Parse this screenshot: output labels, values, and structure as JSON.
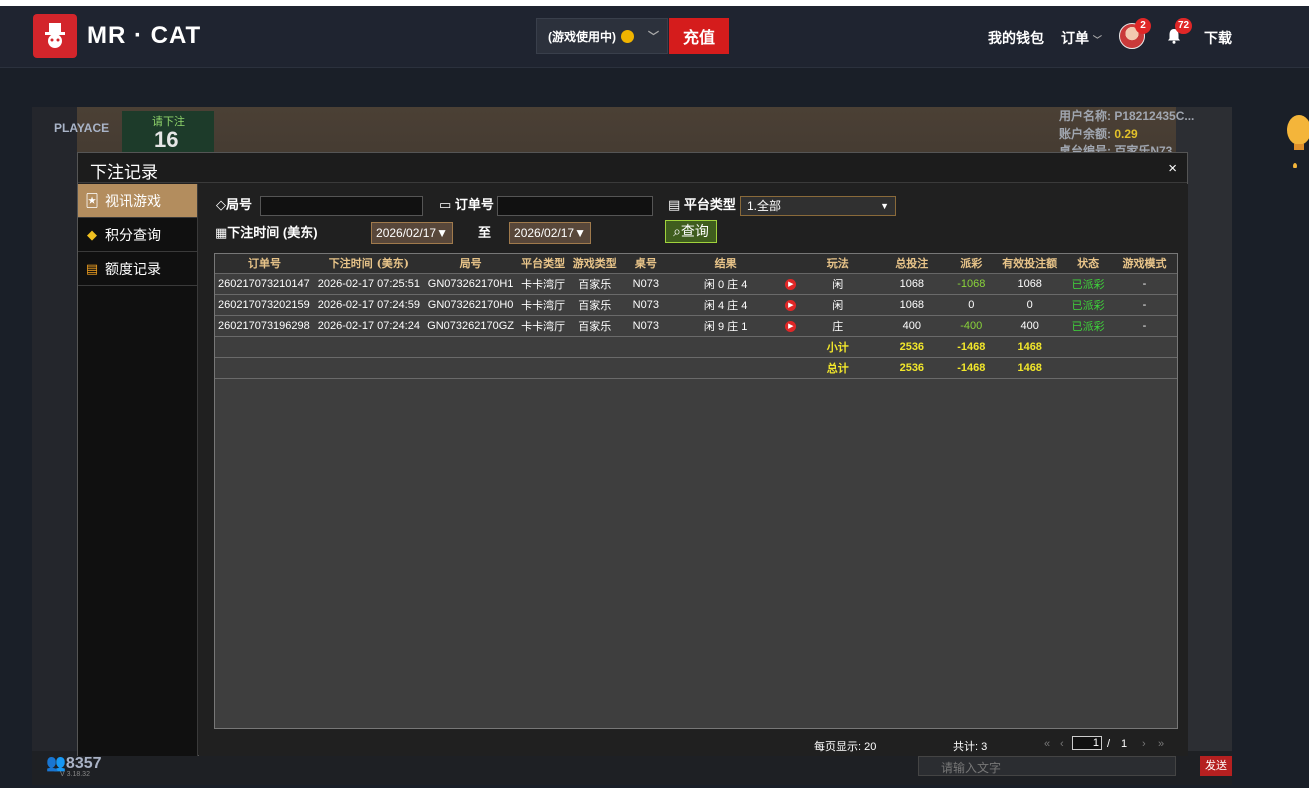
{
  "navbar": {
    "brand": "MR · CAT",
    "wallet_select": "(游戏使用中)",
    "recharge": "充值",
    "my_wallet": "我的钱包",
    "orders": "订单",
    "avatar_badge": "2",
    "bell_badge": "72",
    "download": "下载"
  },
  "game_background": {
    "provider": "PLAYACE",
    "bet_prompt": "请下注",
    "countdown": "16",
    "username": "用户名称: P18212435C...",
    "balance_label": "账户余额:",
    "balance": "0.29",
    "table_label": "桌台编号: 百家乐N73",
    "online_count": "8357",
    "version": "V 3.18.32",
    "chat_placeholder": "请输入文字",
    "send": "发送"
  },
  "modal": {
    "title": "下注记录",
    "close": "×",
    "sidebar": [
      {
        "label": "视讯游戏",
        "icon": "cards-icon",
        "active": true
      },
      {
        "label": "积分查询",
        "icon": "diamond-icon",
        "active": false
      },
      {
        "label": "额度记录",
        "icon": "document-icon",
        "active": false
      }
    ],
    "filters": {
      "round_label": "局号",
      "round_value": "",
      "order_label": "订单号",
      "order_value": "",
      "platform_label": "平台类型",
      "platform_value": "1.全部",
      "time_label": "下注时间 (美东)",
      "date_from": "2026/02/17",
      "to_label": "至",
      "date_to": "2026/02/17",
      "query_button": "查询"
    },
    "table": {
      "headers": [
        "订单号",
        "下注时间 (美东)",
        "局号",
        "平台类型",
        "游戏类型",
        "桌号",
        "结果",
        "",
        "玩法",
        "总投注",
        "派彩",
        "有效投注额",
        "状态",
        "游戏模式"
      ],
      "rows": [
        {
          "order": "260217073210147",
          "time": "2026-02-17 07:25:51",
          "round": "GN073262170H1",
          "platform": "卡卡湾厅",
          "game": "百家乐",
          "table": "N073",
          "result": "闲 0 庄 4",
          "play": "闲",
          "bet": "1068",
          "payout": "-1068",
          "valid": "1068",
          "status": "已派彩",
          "mode": "-"
        },
        {
          "order": "260217073202159",
          "time": "2026-02-17 07:24:59",
          "round": "GN073262170H0",
          "platform": "卡卡湾厅",
          "game": "百家乐",
          "table": "N073",
          "result": "闲 4 庄 4",
          "play": "闲",
          "bet": "1068",
          "payout": "0",
          "valid": "0",
          "status": "已派彩",
          "mode": "-"
        },
        {
          "order": "260217073196298",
          "time": "2026-02-17 07:24:24",
          "round": "GN073262170GZ",
          "platform": "卡卡湾厅",
          "game": "百家乐",
          "table": "N073",
          "result": "闲 9 庄 1",
          "play": "庄",
          "bet": "400",
          "payout": "-400",
          "valid": "400",
          "status": "已派彩",
          "mode": "-"
        }
      ],
      "subtotal": {
        "label": "小计",
        "bet": "2536",
        "payout": "-1468",
        "valid": "1468"
      },
      "total": {
        "label": "总计",
        "bet": "2536",
        "payout": "-1468",
        "valid": "1468"
      }
    },
    "pager": {
      "per_page": "每页显示: 20",
      "total": "共计: 3",
      "current_page": "1",
      "separator": "/",
      "total_pages": "1",
      "first": "«",
      "prev": "‹",
      "next": "›",
      "last": "»"
    }
  },
  "colors": {
    "accent_red": "#d51c1c",
    "sidebar_active": "#b38d5e",
    "header_gold": "#e8c489",
    "positive_green": "#3ed43a",
    "summary_yellow": "#f2e72b"
  }
}
